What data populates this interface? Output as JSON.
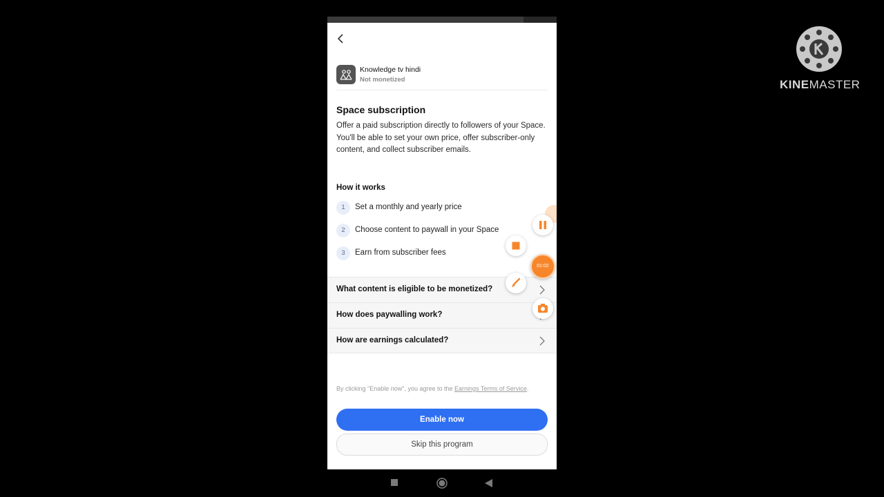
{
  "space": {
    "name": "Knowledge tv hindi",
    "status": "Not monetized"
  },
  "main": {
    "title": "Space subscription",
    "description": "Offer a paid subscription directly to followers of your Space. You'll be able to set your own price, offer subscriber-only content, and collect subscriber emails.",
    "how_title": "How it works",
    "steps": [
      {
        "num": "1",
        "text": "Set a monthly and yearly price"
      },
      {
        "num": "2",
        "text": "Choose content to paywall in your Space"
      },
      {
        "num": "3",
        "text": "Earn from subscriber fees"
      }
    ],
    "faqs": [
      {
        "text": "What content is eligible to be monetized?"
      },
      {
        "text": "How does paywalling work?"
      },
      {
        "text": "How are earnings calculated?"
      }
    ]
  },
  "footer": {
    "terms_prefix": "By clicking \"Enable now\", you agree to the ",
    "terms_link": "Earnings Terms of Service",
    "terms_suffix": ".",
    "enable_label": "Enable now",
    "skip_label": "Skip this program"
  },
  "recorder": {
    "timer": "01:02"
  },
  "watermark": {
    "kine": "KINE",
    "master": "MASTER"
  },
  "colors": {
    "primary": "#2f6ff2",
    "recorder_orange": "#f7862b"
  },
  "icons": [
    "back-arrow-icon",
    "space-icon",
    "chevron-right-icon",
    "pause-icon",
    "stop-icon",
    "brush-icon",
    "camera-icon",
    "recent-apps-icon",
    "home-icon",
    "back-nav-icon",
    "kinemaster-logo"
  ]
}
